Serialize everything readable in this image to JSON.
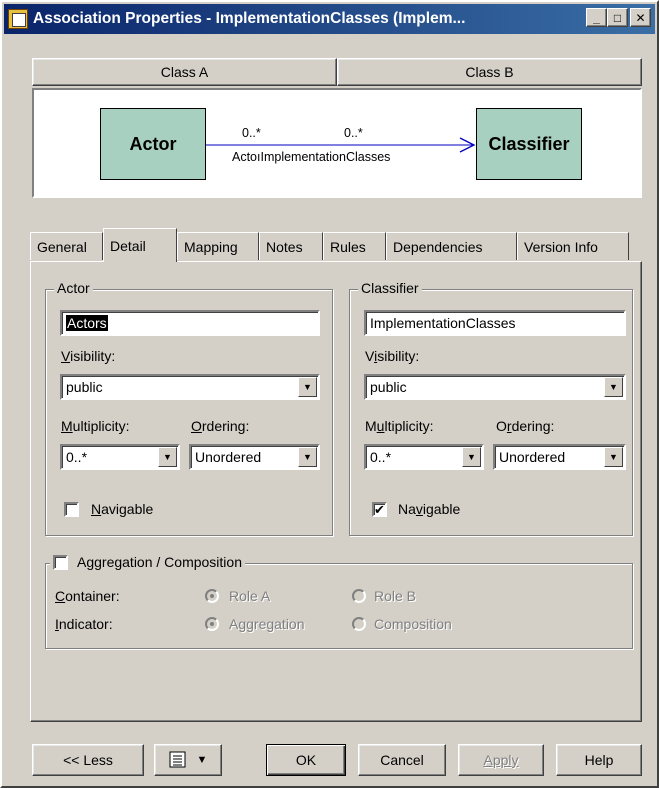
{
  "window": {
    "title": "Association Properties - ImplementationClasses (Implem...",
    "controls": {
      "minimize": "_",
      "maximize": "□",
      "close": "✕"
    }
  },
  "header": {
    "class_a": "Class A",
    "class_b": "Class B"
  },
  "diagram": {
    "left_class": "Actor",
    "right_class": "Classifier",
    "mult_a": "0..*",
    "mult_b": "0..*",
    "role_text": "ActoıImplementationClasses",
    "line_color": "#0000c0",
    "class_fill": "#a8d0c0"
  },
  "tabs": [
    "General",
    "Detail",
    "Mapping",
    "Notes",
    "Rules",
    "Dependencies",
    "Version Info"
  ],
  "active_tab": "Detail",
  "actor": {
    "legend": "Actor",
    "role_name": "Actors",
    "visibility_label": "Visibility:",
    "visibility": "public",
    "multiplicity_label": "Multiplicity:",
    "multiplicity": "0..*",
    "ordering_label": "Ordering:",
    "ordering": "Unordered",
    "navigable_label": "Navigable",
    "navigable": false
  },
  "classifier": {
    "legend": "Classifier",
    "role_name": "ImplementationClasses",
    "visibility_label": "Visibility:",
    "visibility": "public",
    "multiplicity_label": "Multiplicity:",
    "multiplicity": "0..*",
    "ordering_label": "Ordering:",
    "ordering": "Unordered",
    "navigable_label": "Navigable",
    "navigable": true
  },
  "aggregation": {
    "legend": "Aggregation / Composition",
    "checked": false,
    "container_label": "Container:",
    "indicator_label": "Indicator:",
    "role_a": "Role A",
    "role_b": "Role B",
    "aggregation": "Aggregation",
    "composition": "Composition"
  },
  "buttons": {
    "less": "<< Less",
    "ok": "OK",
    "cancel": "Cancel",
    "apply": "Apply",
    "help": "Help"
  },
  "icons": {
    "checkmark": "✔",
    "dropdown": "▼",
    "menu_icon": "list-icon"
  }
}
